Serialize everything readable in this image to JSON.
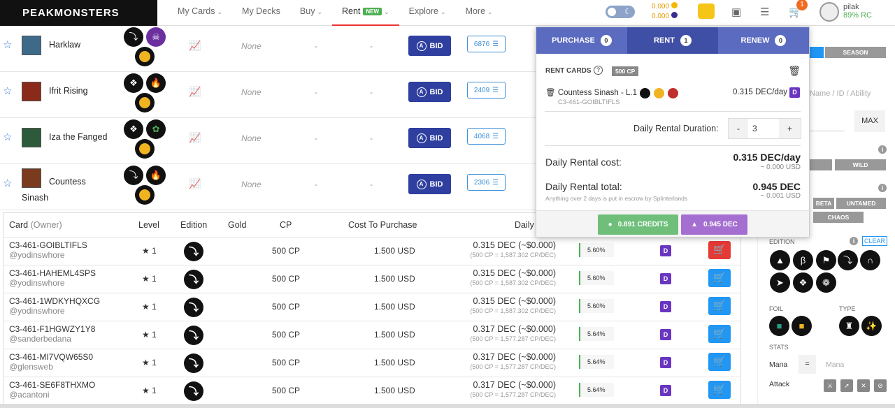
{
  "nav": {
    "logo": "PEAKMONSTERS",
    "items": [
      {
        "label": "My Cards",
        "chev": true
      },
      {
        "label": "My Decks",
        "chev": false
      },
      {
        "label": "Buy",
        "chev": true
      },
      {
        "label": "Rent",
        "chev": true,
        "badge": "NEW",
        "active": true
      },
      {
        "label": "Explore",
        "chev": true
      },
      {
        "label": "More",
        "chev": true
      }
    ],
    "balance_top": "0.000",
    "balance_bottom": "0.000",
    "cart_count": "1",
    "username": "pilak",
    "rc": "89% RC"
  },
  "cards": [
    {
      "name": "Harklaw",
      "none": "None",
      "dash1": "-",
      "dash2": "-",
      "bid": "BID",
      "count": "6876",
      "icons": [
        "neutral",
        "death",
        "gold"
      ]
    },
    {
      "name": "Ifrit Rising",
      "none": "None",
      "dash1": "-",
      "dash2": "-",
      "bid": "BID",
      "count": "2409",
      "icons": [
        "rare",
        "fire",
        "gold"
      ]
    },
    {
      "name": "Iza the Fanged",
      "none": "None",
      "dash1": "-",
      "dash2": "-",
      "bid": "BID",
      "count": "4068",
      "icons": [
        "rare",
        "earth",
        "gold"
      ]
    },
    {
      "name": "Countess Sinash",
      "none": "None",
      "dash1": "-",
      "dash2": "-",
      "bid": "BID",
      "count": "2306",
      "icons": [
        "neutral",
        "fire",
        "gold"
      ]
    }
  ],
  "table": {
    "headers": {
      "card": "Card",
      "owner": "(Owner)",
      "level": "Level",
      "edition": "Edition",
      "gold": "Gold",
      "cp": "CP",
      "cost": "Cost To Purchase",
      "daily": "Daily"
    },
    "rows": [
      {
        "uid": "C3-461-GOIBLTIFLS",
        "owner": "@yodinswhore",
        "level": "★ 1",
        "cp": "500 CP",
        "cost": "1.500 USD",
        "dec": "0.315 DEC (~$0.000)",
        "sub": "(500 CP = 1,587.302 CP/DEC)",
        "pct": "5.60%",
        "d": "D",
        "in_cart": true
      },
      {
        "uid": "C3-461-HAHEML4SPS",
        "owner": "@yodinswhore",
        "level": "★ 1",
        "cp": "500 CP",
        "cost": "1.500 USD",
        "dec": "0.315 DEC (~$0.000)",
        "sub": "(500 CP = 1,587.302 CP/DEC)",
        "pct": "5.60%",
        "d": "D",
        "in_cart": false
      },
      {
        "uid": "C3-461-1WDKYHQXCG",
        "owner": "@yodinswhore",
        "level": "★ 1",
        "cp": "500 CP",
        "cost": "1.500 USD",
        "dec": "0.315 DEC (~$0.000)",
        "sub": "(500 CP = 1,587.302 CP/DEC)",
        "pct": "5.60%",
        "d": "D",
        "in_cart": false
      },
      {
        "uid": "C3-461-F1HGWZY1Y8",
        "owner": "@sanderbedana",
        "level": "★ 1",
        "cp": "500 CP",
        "cost": "1.500 USD",
        "dec": "0.317 DEC (~$0.000)",
        "sub": "(500 CP = 1,577.287 CP/DEC)",
        "pct": "5.64%",
        "d": "D",
        "in_cart": false
      },
      {
        "uid": "C3-461-MI7VQW65S0",
        "owner": "@glensweb",
        "level": "★ 1",
        "cp": "500 CP",
        "cost": "1.500 USD",
        "dec": "0.317 DEC (~$0.000)",
        "sub": "(500 CP = 1,577.287 CP/DEC)",
        "pct": "5.64%",
        "d": "D",
        "in_cart": false
      },
      {
        "uid": "C3-461-SE6F8THXMO",
        "owner": "@acantoni",
        "level": "★ 1",
        "cp": "500 CP",
        "cost": "1.500 USD",
        "dec": "0.317 DEC (~$0.000)",
        "sub": "(500 CP = 1,577.287 CP/DEC)",
        "pct": "5.64%",
        "d": "D",
        "in_cart": false
      }
    ]
  },
  "filters": {
    "season": "SEASON",
    "search_placeholder": "Name / ID / Ability",
    "max": "MAX",
    "wild": "WILD",
    "beta": "BETA",
    "untamed": "UNTAMED",
    "chaos": "CHAOS",
    "edition_label": "EDITION",
    "clear": "CLEAR",
    "foil_label": "FOIL",
    "type_label": "TYPE",
    "stats_label": "STATS",
    "mana_label": "Mana",
    "mana_op": "=",
    "mana_placeholder": "Mana",
    "attack_label": "Attack"
  },
  "popup": {
    "tabs": [
      {
        "label": "PURCHASE",
        "count": "0"
      },
      {
        "label": "RENT",
        "count": "1",
        "active": true
      },
      {
        "label": "RENEW",
        "count": "0"
      }
    ],
    "rent_cards_title": "RENT CARDS",
    "cp_badge": "500 CP",
    "card_name": "Countess Sinash - L.1",
    "card_id": "C3-461-GOIBLTIFLS",
    "card_price": "0.315 DEC/day",
    "card_currency": "D",
    "duration_label": "Daily Rental Duration:",
    "duration_minus": "-",
    "duration_value": "3",
    "duration_plus": "+",
    "daily_cost_label": "Daily Rental cost:",
    "daily_cost_value": "0.315 DEC/day",
    "daily_cost_usd": "~ 0.000 USD",
    "total_label": "Daily Rental total:",
    "total_value": "0.945 DEC",
    "total_usd": "~ 0.001 USD",
    "escrow_note": "Anything over 2 days is put in escrow by Splinterlands",
    "pay_credits": "0.891 CREDITS",
    "pay_dec": "0.945 DEC"
  },
  "colors": {
    "accent": "#2f3f9f",
    "tab_active": "#3f4fa5",
    "tab": "#5b6bc0",
    "credits": "#6fbf7b",
    "dec": "#a46fd0",
    "cart": "#2196f3",
    "cart_active": "#e53935"
  }
}
